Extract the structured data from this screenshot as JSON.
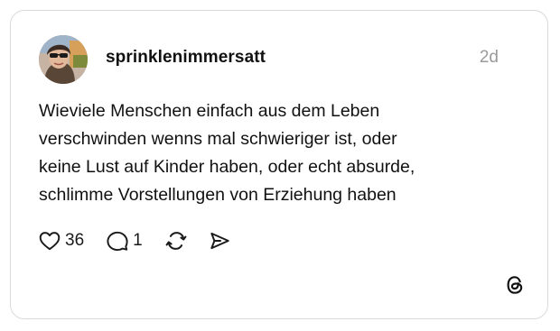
{
  "post": {
    "username": "sprinklenimmersatt",
    "timestamp": "2d",
    "text_lines": [
      "Wieviele Menschen einfach aus dem Leben",
      "verschwinden wenns mal schwieriger ist, oder",
      "keine Lust auf Kinder haben, oder echt absurde,",
      "schlimme Vorstellungen von Erziehung haben"
    ],
    "likes": "36",
    "replies": "1"
  },
  "icons": {
    "like": "heart-icon",
    "reply": "comment-icon",
    "repost": "repost-icon",
    "share": "send-icon",
    "brand": "threads-logo-icon"
  },
  "colors": {
    "border": "#d9d9d9",
    "text": "#111111",
    "muted": "#9a9a9a"
  }
}
